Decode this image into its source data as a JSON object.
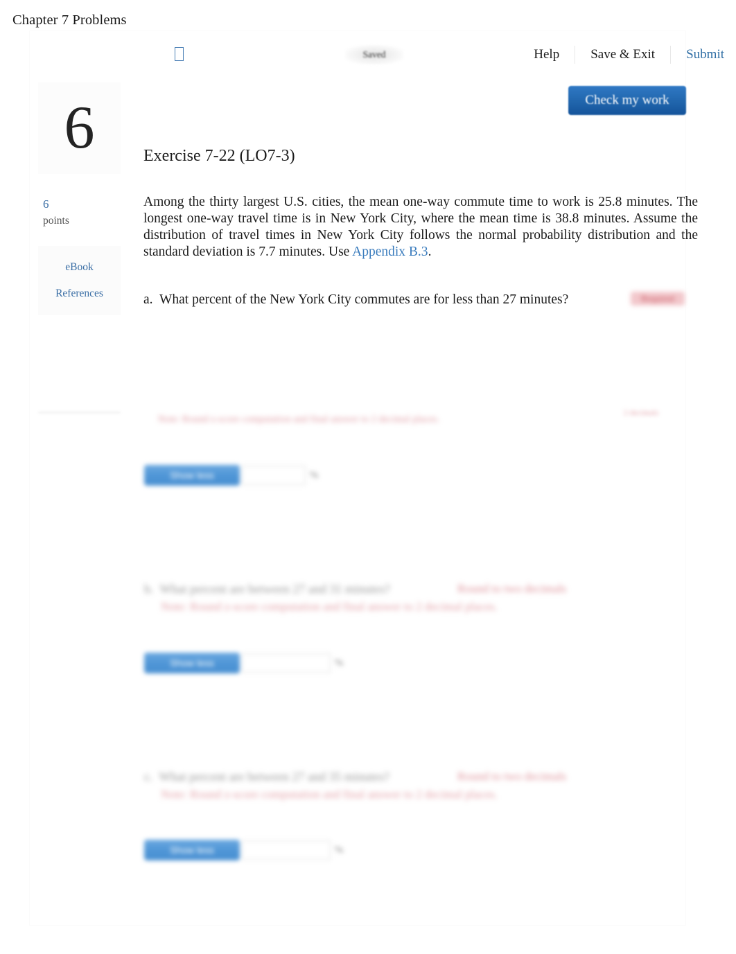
{
  "header": {
    "title": "Chapter 7 Problems",
    "title_icon": "missing-glyph-box-icon",
    "saved_status": "Saved",
    "links": [
      {
        "label": "Help"
      },
      {
        "label": "Save & Exit"
      },
      {
        "label": "Submit"
      }
    ],
    "check_my_work_label": "Check my work"
  },
  "rail": {
    "question_number": "6",
    "points_value": "6",
    "points_label": "points",
    "ebook_label": "eBook",
    "references_label": "References"
  },
  "main": {
    "exercise_title": "Exercise 7-22 (LO7-3)",
    "stem_text_before_link": "Among the thirty largest U.S. cities, the mean one-way commute time to work is 25.8 minutes. The longest one-way travel time is in New York City, where the mean time is 38.8 minutes. Assume the distribution of travel times in New York City follows the normal probability distribution and the standard deviation is 7.7 minutes. Use ",
    "stem_link_label": "Appendix B.3",
    "stem_text_after_link": ".",
    "part_a": {
      "letter": "a.",
      "question": "What percent of the New York City commutes are for less than 27 minutes?",
      "badge": "Required",
      "hint": "Note: Round z-score computation and final answer to 2 decimal places.",
      "hint_right": "2 decimals",
      "answer_button_label": "Show less",
      "answer_value": "",
      "answer_unit": "%"
    },
    "part_b": {
      "letter": "b.",
      "question_line1": "What percent are between 27 and 31 minutes?",
      "question_line2": "Note: Round z-score computation and final answer to 2 decimal places.",
      "badge": "Round to two decimals",
      "answer_button_label": "Show less",
      "answer_value": "",
      "answer_unit": "%"
    },
    "part_c": {
      "letter": "c.",
      "question_line1": "What percent are between 27 and 35 minutes?",
      "question_line2": "Note: Round z-score computation and final answer to 2 decimal places.",
      "badge": "Round to two decimals",
      "answer_button_label": "Show less",
      "answer_value": "",
      "answer_unit": "%"
    }
  },
  "colors": {
    "link_blue": "#3a7cbd",
    "submit_blue": "#2e6da4",
    "button_blue": "#2166ad",
    "text_dark": "#1b1b1b",
    "redaction_red": "#c64a58"
  }
}
